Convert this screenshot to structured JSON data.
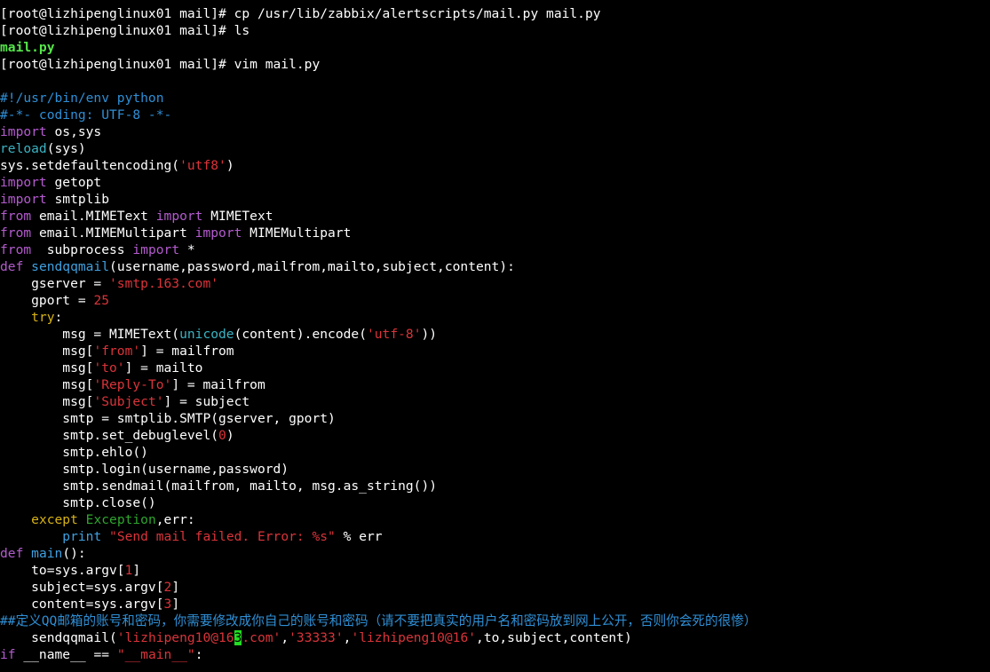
{
  "terminal": {
    "colors": {
      "background": "#000000",
      "text": "#ffffff",
      "keyword": "#b45bcf",
      "function_name": "#3fa0e0",
      "builtin": "#3bb3c3",
      "string": "#d9343a",
      "comment": "#2f8fd6",
      "try_except": "#d7b317",
      "exception_class": "#2fa52f",
      "executable_file": "#55e64a",
      "cursor": "#22dd22"
    },
    "lines": [
      [
        {
          "t": "plain",
          "text": "[root@lizhipenglinux01 mail]# cp /usr/lib/zabbix/alertscripts/mail.py mail.py"
        }
      ],
      [
        {
          "t": "plain",
          "text": "[root@lizhipenglinux01 mail]# ls"
        }
      ],
      [
        {
          "t": "file",
          "text": "mail.py"
        }
      ],
      [
        {
          "t": "plain",
          "text": "[root@lizhipenglinux01 mail]# vim mail.py"
        }
      ],
      [
        {
          "t": "plain",
          "text": ""
        }
      ],
      [
        {
          "t": "comment",
          "text": "#!/usr/bin/env python"
        }
      ],
      [
        {
          "t": "comment",
          "text": "#-*- coding: UTF-8 -*-"
        }
      ],
      [
        {
          "t": "kw",
          "text": "import"
        },
        {
          "t": "plain",
          "text": " os,sys"
        }
      ],
      [
        {
          "t": "builtin",
          "text": "reload"
        },
        {
          "t": "plain",
          "text": "(sys)"
        }
      ],
      [
        {
          "t": "plain",
          "text": "sys.setdefaultencoding("
        },
        {
          "t": "str",
          "text": "'utf8'"
        },
        {
          "t": "plain",
          "text": ")"
        }
      ],
      [
        {
          "t": "kw",
          "text": "import"
        },
        {
          "t": "plain",
          "text": " getopt"
        }
      ],
      [
        {
          "t": "kw",
          "text": "import"
        },
        {
          "t": "plain",
          "text": " smtplib"
        }
      ],
      [
        {
          "t": "kw",
          "text": "from"
        },
        {
          "t": "plain",
          "text": " email.MIMEText "
        },
        {
          "t": "kw",
          "text": "import"
        },
        {
          "t": "plain",
          "text": " MIMEText"
        }
      ],
      [
        {
          "t": "kw",
          "text": "from"
        },
        {
          "t": "plain",
          "text": " email.MIMEMultipart "
        },
        {
          "t": "kw",
          "text": "import"
        },
        {
          "t": "plain",
          "text": " MIMEMultipart"
        }
      ],
      [
        {
          "t": "kw",
          "text": "from"
        },
        {
          "t": "plain",
          "text": "  subprocess "
        },
        {
          "t": "kw",
          "text": "import"
        },
        {
          "t": "plain",
          "text": " *"
        }
      ],
      [
        {
          "t": "kw",
          "text": "def"
        },
        {
          "t": "plain",
          "text": " "
        },
        {
          "t": "func",
          "text": "sendqqmail"
        },
        {
          "t": "plain",
          "text": "(username,password,mailfrom,mailto,subject,content):"
        }
      ],
      [
        {
          "t": "plain",
          "text": "    gserver = "
        },
        {
          "t": "str",
          "text": "'smtp.163.com'"
        }
      ],
      [
        {
          "t": "plain",
          "text": "    gport = "
        },
        {
          "t": "num",
          "text": "25"
        }
      ],
      [
        {
          "t": "plain",
          "text": "    "
        },
        {
          "t": "try",
          "text": "try"
        },
        {
          "t": "plain",
          "text": ":"
        }
      ],
      [
        {
          "t": "plain",
          "text": "        msg = MIMEText("
        },
        {
          "t": "builtin",
          "text": "unicode"
        },
        {
          "t": "plain",
          "text": "(content).encode("
        },
        {
          "t": "str",
          "text": "'utf-8'"
        },
        {
          "t": "plain",
          "text": "))"
        }
      ],
      [
        {
          "t": "plain",
          "text": "        msg["
        },
        {
          "t": "str",
          "text": "'from'"
        },
        {
          "t": "plain",
          "text": "] = mailfrom"
        }
      ],
      [
        {
          "t": "plain",
          "text": "        msg["
        },
        {
          "t": "str",
          "text": "'to'"
        },
        {
          "t": "plain",
          "text": "] = mailto"
        }
      ],
      [
        {
          "t": "plain",
          "text": "        msg["
        },
        {
          "t": "str",
          "text": "'Reply-To'"
        },
        {
          "t": "plain",
          "text": "] = mailfrom"
        }
      ],
      [
        {
          "t": "plain",
          "text": "        msg["
        },
        {
          "t": "str",
          "text": "'Subject'"
        },
        {
          "t": "plain",
          "text": "] = subject"
        }
      ],
      [
        {
          "t": "plain",
          "text": "        smtp = smtplib.SMTP(gserver, gport)"
        }
      ],
      [
        {
          "t": "plain",
          "text": "        smtp.set_debuglevel("
        },
        {
          "t": "num",
          "text": "0"
        },
        {
          "t": "plain",
          "text": ")"
        }
      ],
      [
        {
          "t": "plain",
          "text": "        smtp.ehlo()"
        }
      ],
      [
        {
          "t": "plain",
          "text": "        smtp.login(username,password)"
        }
      ],
      [
        {
          "t": "plain",
          "text": "        smtp.sendmail(mailfrom, mailto, msg.as_string())"
        }
      ],
      [
        {
          "t": "plain",
          "text": "        smtp.close()"
        }
      ],
      [
        {
          "t": "plain",
          "text": "    "
        },
        {
          "t": "except",
          "text": "except"
        },
        {
          "t": "plain",
          "text": " "
        },
        {
          "t": "exc",
          "text": "Exception"
        },
        {
          "t": "plain",
          "text": ",err:"
        }
      ],
      [
        {
          "t": "plain",
          "text": "        "
        },
        {
          "t": "print",
          "text": "print"
        },
        {
          "t": "plain",
          "text": " "
        },
        {
          "t": "str",
          "text": "\"Send mail failed. Error: %s\""
        },
        {
          "t": "plain",
          "text": " % err"
        }
      ],
      [
        {
          "t": "kw",
          "text": "def"
        },
        {
          "t": "plain",
          "text": " "
        },
        {
          "t": "func",
          "text": "main"
        },
        {
          "t": "plain",
          "text": "():"
        }
      ],
      [
        {
          "t": "plain",
          "text": "    to=sys.argv["
        },
        {
          "t": "num",
          "text": "1"
        },
        {
          "t": "plain",
          "text": "]"
        }
      ],
      [
        {
          "t": "plain",
          "text": "    subject=sys.argv["
        },
        {
          "t": "num",
          "text": "2"
        },
        {
          "t": "plain",
          "text": "]"
        }
      ],
      [
        {
          "t": "plain",
          "text": "    content=sys.argv["
        },
        {
          "t": "num",
          "text": "3"
        },
        {
          "t": "plain",
          "text": "]"
        }
      ],
      [
        {
          "t": "comment",
          "text": "##定义QQ邮箱的账号和密码，你需要修改成你自己的账号和密码（请不要把真实的用户名和密码放到网上公开，否则你会死的很惨）"
        }
      ],
      [
        {
          "t": "plain",
          "text": "    sendqqmail("
        },
        {
          "t": "str",
          "text": "'lizhipeng10@16"
        },
        {
          "t": "cursor",
          "text": "3"
        },
        {
          "t": "str",
          "text": ".com'"
        },
        {
          "t": "plain",
          "text": ","
        },
        {
          "t": "str",
          "text": "'33333'"
        },
        {
          "t": "plain",
          "text": ","
        },
        {
          "t": "str",
          "text": "'lizhipeng10@16'"
        },
        {
          "t": "plain",
          "text": ",to,subject,content)"
        }
      ],
      [
        {
          "t": "kw",
          "text": "if"
        },
        {
          "t": "plain",
          "text": " __name__ == "
        },
        {
          "t": "str",
          "text": "\"__main__\""
        },
        {
          "t": "plain",
          "text": ":"
        }
      ]
    ]
  }
}
